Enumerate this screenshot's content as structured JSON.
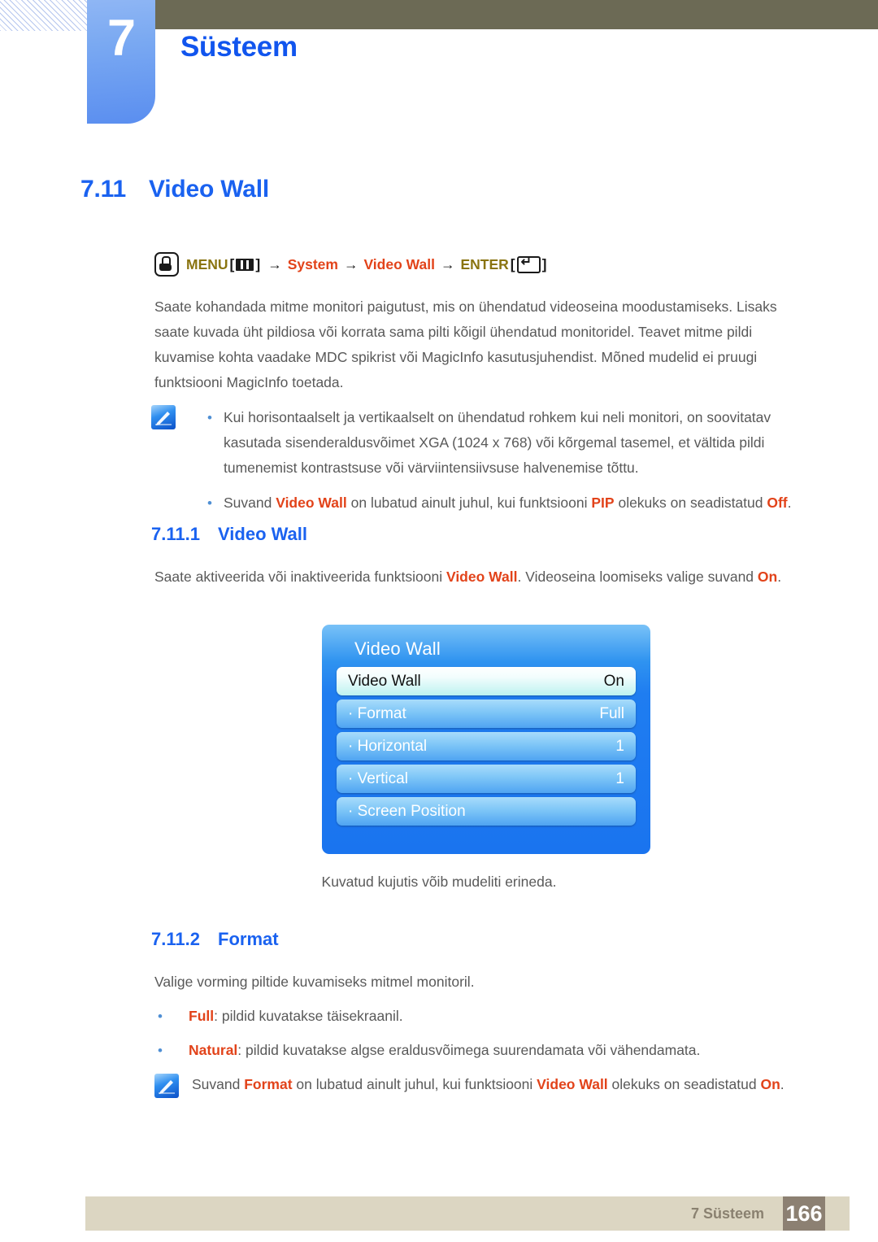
{
  "chapter": {
    "number": "7",
    "title": "Süsteem"
  },
  "section": {
    "number": "7.11",
    "title": "Video Wall"
  },
  "menu_path": {
    "icon": "hand-press-icon",
    "menu_label": "MENU",
    "menu_glyph": "menu-bars-icon",
    "arrow": "→",
    "bracket_open": "[",
    "bracket_close": "]",
    "step_system": "System",
    "step_video_wall": "Video Wall",
    "enter_label": "ENTER",
    "enter_glyph": "enter-key-icon"
  },
  "intro_paragraph": "Saate kohandada mitme monitori paigutust, mis on ühendatud videoseina moodustamiseks. Lisaks saate kuvada üht pildiosa või korrata sama pilti kõigil ühendatud monitoridel. Teavet mitme pildi kuvamise kohta vaadake MDC spikrist või MagicInfo kasutusjuhendist. Mõned mudelid ei pruugi funktsiooni MagicInfo toetada.",
  "note_block_1": {
    "icon": "note-pen-icon",
    "bullet": "•",
    "items": [
      {
        "text": "Kui horisontaalselt ja vertikaalselt on ühendatud rohkem kui neli monitori, on soovitatav kasutada sisenderaldusvõimet XGA (1024 x 768) või kõrgemal tasemel, et vältida pildi tumenemist kontrastsuse või värviintensiivsuse halvenemise tõttu."
      },
      {
        "parts": [
          {
            "text": "Suvand ",
            "highlight": false
          },
          {
            "text": "Video Wall",
            "highlight": true
          },
          {
            "text": " on lubatud ainult juhul, kui funktsiooni ",
            "highlight": false
          },
          {
            "text": "PIP",
            "highlight": true
          },
          {
            "text": " olekuks on seadistatud ",
            "highlight": false
          },
          {
            "text": "Off",
            "highlight": true
          },
          {
            "text": ".",
            "highlight": false
          }
        ]
      }
    ]
  },
  "subsection_1": {
    "number": "7.11.1",
    "title": "Video Wall",
    "paragraph_parts": [
      {
        "text": "Saate aktiveerida või inaktiveerida funktsiooni ",
        "highlight": false
      },
      {
        "text": "Video Wall",
        "highlight": true
      },
      {
        "text": ". Videoseina loomiseks valige suvand ",
        "highlight": false
      },
      {
        "text": "On",
        "highlight": true
      },
      {
        "text": ".",
        "highlight": false
      }
    ]
  },
  "osd": {
    "title": "Video Wall",
    "rows": [
      {
        "label": "Video Wall",
        "value": "On",
        "selected": true
      },
      {
        "label": "· Format",
        "value": "Full",
        "selected": false
      },
      {
        "label": "· Horizontal",
        "value": "1",
        "selected": false
      },
      {
        "label": "· Vertical",
        "value": "1",
        "selected": false
      },
      {
        "label": "· Screen Position",
        "value": "",
        "selected": false
      }
    ],
    "caption": "Kuvatud kujutis võib mudeliti erineda."
  },
  "subsection_2": {
    "number": "7.11.2",
    "title": "Format",
    "paragraph": "Valige vorming piltide kuvamiseks mitmel monitoril.",
    "bullet": "•",
    "items": [
      {
        "parts": [
          {
            "text": "Full",
            "highlight": true
          },
          {
            "text": ": pildid kuvatakse täisekraanil.",
            "highlight": false
          }
        ]
      },
      {
        "parts": [
          {
            "text": "Natural",
            "highlight": true
          },
          {
            "text": ": pildid kuvatakse algse eraldusvõimega suurendamata või vähendamata.",
            "highlight": false
          }
        ]
      }
    ]
  },
  "note_block_2": {
    "icon": "note-pen-icon",
    "parts": [
      {
        "text": "Suvand ",
        "highlight": false
      },
      {
        "text": "Format",
        "highlight": true
      },
      {
        "text": " on lubatud ainult juhul, kui funktsiooni ",
        "highlight": false
      },
      {
        "text": "Video Wall",
        "highlight": true
      },
      {
        "text": " olekuks on seadistatud ",
        "highlight": false
      },
      {
        "text": "On",
        "highlight": true
      },
      {
        "text": ".",
        "highlight": false
      }
    ]
  },
  "footer": {
    "label": "7 Süsteem",
    "page_number": "166"
  },
  "colors": {
    "heading_blue": "#1a62f0",
    "accent_orange": "#e2431a",
    "menu_olive": "#8a7410",
    "band_olive": "#6c6a55",
    "footer_beige": "#dcd6c2",
    "footer_page_box": "#8c8072",
    "body_gray": "#595959",
    "osd_blue": "#1f7df0"
  }
}
